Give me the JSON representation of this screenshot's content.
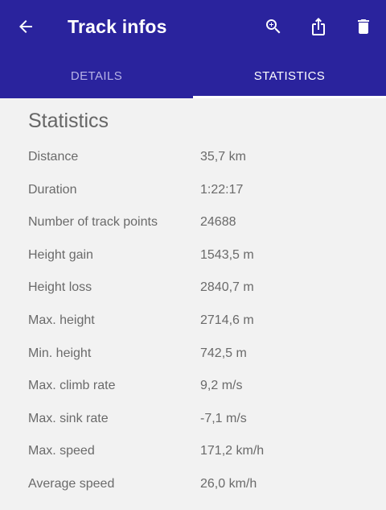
{
  "appbar": {
    "title": "Track infos",
    "icons": [
      "back-arrow-icon",
      "zoom-in-icon",
      "share-icon",
      "delete-icon"
    ],
    "color": "#2a239d"
  },
  "tabs": [
    {
      "label": "DETAILS",
      "active": false
    },
    {
      "label": "STATISTICS",
      "active": true
    }
  ],
  "statistics": {
    "title": "Statistics",
    "rows": [
      {
        "label": "Distance",
        "value": "35,7 km"
      },
      {
        "label": "Duration",
        "value": "1:22:17"
      },
      {
        "label": "Number of track points",
        "value": "24688"
      },
      {
        "label": "Height gain",
        "value": "1543,5 m"
      },
      {
        "label": "Height loss",
        "value": "2840,7 m"
      },
      {
        "label": "Max. height",
        "value": "2714,6 m"
      },
      {
        "label": "Min. height",
        "value": "742,5 m"
      },
      {
        "label": "Max. climb rate",
        "value": "9,2 m/s"
      },
      {
        "label": "Max. sink rate",
        "value": "-7,1 m/s"
      },
      {
        "label": "Max. speed",
        "value": "171,2 km/h"
      },
      {
        "label": "Average speed",
        "value": "26,0 km/h"
      }
    ]
  }
}
